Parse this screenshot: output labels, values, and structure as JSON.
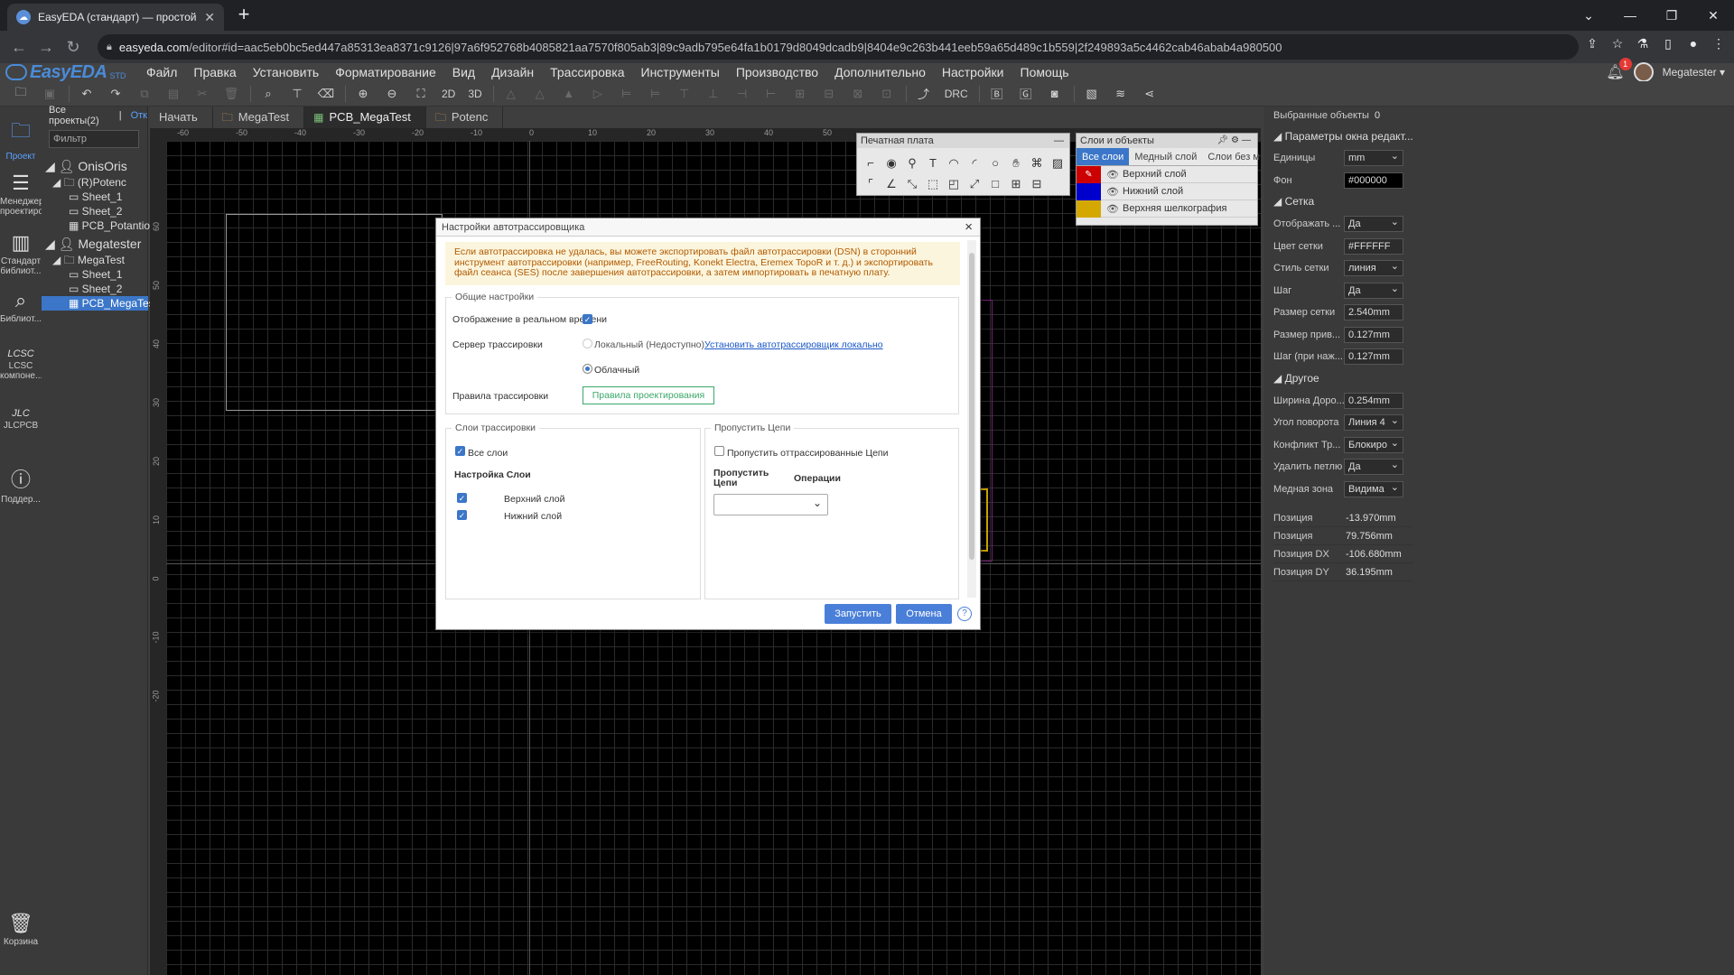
{
  "browser": {
    "tab_title": "EasyEDA (стандарт) — простой и",
    "url_host": "easyeda.com",
    "url_rest": "/editor#id=aac5eb0bc5ed447a85313ea8371c9126|97a6f952768b4085821aa7570f805ab3|89c9adb795e64fa1b0179d8049dcadb9|8404e9c263b441eeb59a65d489c1b559|2f249893a5c4462cab46abab4a980500"
  },
  "app": {
    "logo": "EasyEDA",
    "logo_suffix": "STD",
    "menus": [
      "Файл",
      "Правка",
      "Установить",
      "Форматирование",
      "Вид",
      "Дизайн",
      "Трассировка",
      "Инструменты",
      "Производство",
      "Дополнительно",
      "Настройки",
      "Помощь"
    ],
    "notifications": "1",
    "username": "Megatester",
    "toolbar_2d": "2D",
    "toolbar_3d": "3D",
    "toolbar_drc": "DRC"
  },
  "leftbar": [
    {
      "label": "Проект",
      "icon": "folder-icon"
    },
    {
      "label": "Менеджер проектиро",
      "icon": "list-icon"
    },
    {
      "label": "Стандарт библиот...",
      "icon": "chip-icon"
    },
    {
      "label": "Библиот...",
      "icon": "search-icon"
    },
    {
      "label": "LCSC компоне...",
      "icon": "lcsc-icon"
    },
    {
      "label": "JLCPCB",
      "icon": "jlc-icon"
    },
    {
      "label": "Поддер...",
      "icon": "help-icon"
    },
    {
      "label": "Корзина",
      "icon": "trash-icon"
    }
  ],
  "tree": {
    "header_all": "Все проекты(2)",
    "header_sep": "|",
    "header_open": "Отк",
    "filter_placeholder": "Фильтр",
    "nodes": [
      "OnisOris",
      "(R)Potenc",
      "Sheet_1",
      "Sheet_2",
      "PCB_Potantiostat",
      "Megatester",
      "MegaTest",
      "Sheet_1",
      "Sheet_2",
      "PCB_MegaTest"
    ]
  },
  "doc_tabs": [
    "Начать",
    "MegaTest",
    "PCB_MegaTest",
    "Potenc"
  ],
  "ruler_top": [
    "-60",
    "-50",
    "-40",
    "-30",
    "-20",
    "-10",
    "0",
    "10",
    "20",
    "30",
    "40",
    "50"
  ],
  "ruler_left": [
    "60",
    "50",
    "40",
    "30",
    "20",
    "10",
    "0",
    "-10",
    "-20"
  ],
  "pcb_window": {
    "title": "Печатная плата",
    "minimize": "—"
  },
  "layers_window": {
    "title": "Слои и объекты",
    "tabs": [
      "Все слои",
      "Медный слой",
      "Слои без м"
    ],
    "rows": [
      {
        "name": "Верхний слой",
        "color": "#cc0000"
      },
      {
        "name": "Нижний слой",
        "color": "#0000cc"
      },
      {
        "name": "Верхняя шелкография",
        "color": "#d4a800"
      }
    ]
  },
  "right_panel": {
    "selected_label": "Выбранные объекты",
    "selected_count": "0",
    "sec_params": "Параметры окна редакт...",
    "units_label": "Единицы",
    "units_value": "mm",
    "bg_label": "Фон",
    "bg_value": "#000000",
    "sec_grid": "Сетка",
    "show_label": "Отображать ...",
    "show_value": "Да",
    "gridcolor_label": "Цвет сетки",
    "gridcolor_value": "#FFFFFF",
    "gridstyle_label": "Стиль сетки",
    "gridstyle_value": "линия",
    "step_label": "Шаг",
    "step_value": "Да",
    "gridsize_label": "Размер сетки",
    "gridsize_value": "2.540mm",
    "snapsize_label": "Размер прив...",
    "snapsize_value": "0.127mm",
    "altstep_label": "Шаг (при наж...",
    "altstep_value": "0.127mm",
    "sec_other": "Другое",
    "trackw_label": "Ширина Доро...",
    "trackw_value": "0.254mm",
    "rot_label": "Угол поворота",
    "rot_value": "Линия 4",
    "conflict_label": "Конфликт Тр...",
    "conflict_value": "Блокиро",
    "loop_label": "Удалить петлю",
    "loop_value": "Да",
    "copper_label": "Медная зона",
    "copper_value": "Видима",
    "posx_label": "Позиция",
    "posx_value": "-13.970mm",
    "posy_label": "Позиция",
    "posy_value": "79.756mm",
    "posdx_label": "Позиция DX",
    "posdx_value": "-106.680mm",
    "posdy_label": "Позиция DY",
    "posdy_value": "36.195mm"
  },
  "dialog": {
    "title": "Настройки автотрассировщика",
    "close": "×",
    "warning": "Если автотрассировка не удалась, вы можете экспортировать файл автотрассировки (DSN) в сторонний инструмент автотрассировки (например, FreeRouting, Konekt Electra, Eremex TopoR и т. д.) и экспортировать файл сеанса (SES) после завершения автотрассировки, а затем импортировать в печатную плату.",
    "general_legend": "Общие настройки",
    "realtime_label": "Отображение в реальном времени",
    "server_label": "Сервер трассировки",
    "local_option": "Локальный (Недоступно)",
    "install_link": "Установить автотрассировщик локально",
    "cloud_option": "Облачный",
    "rules_label": "Правила трассировки",
    "rules_button": "Правила проектирования",
    "layers_legend": "Слои трассировки",
    "all_layers": "Все слои",
    "layer_settings": "Настройка Слои",
    "layer_top": "Верхний слой",
    "layer_bottom": "Нижний слой",
    "skip_legend": "Пропустить Цепи",
    "skip_routed": "Пропустить оттрассированные Цепи",
    "skip_nets_col": "Пропустить Цепи",
    "operations_col": "Операции",
    "run_button": "Запустить",
    "cancel_button": "Отмена",
    "help": "?"
  }
}
